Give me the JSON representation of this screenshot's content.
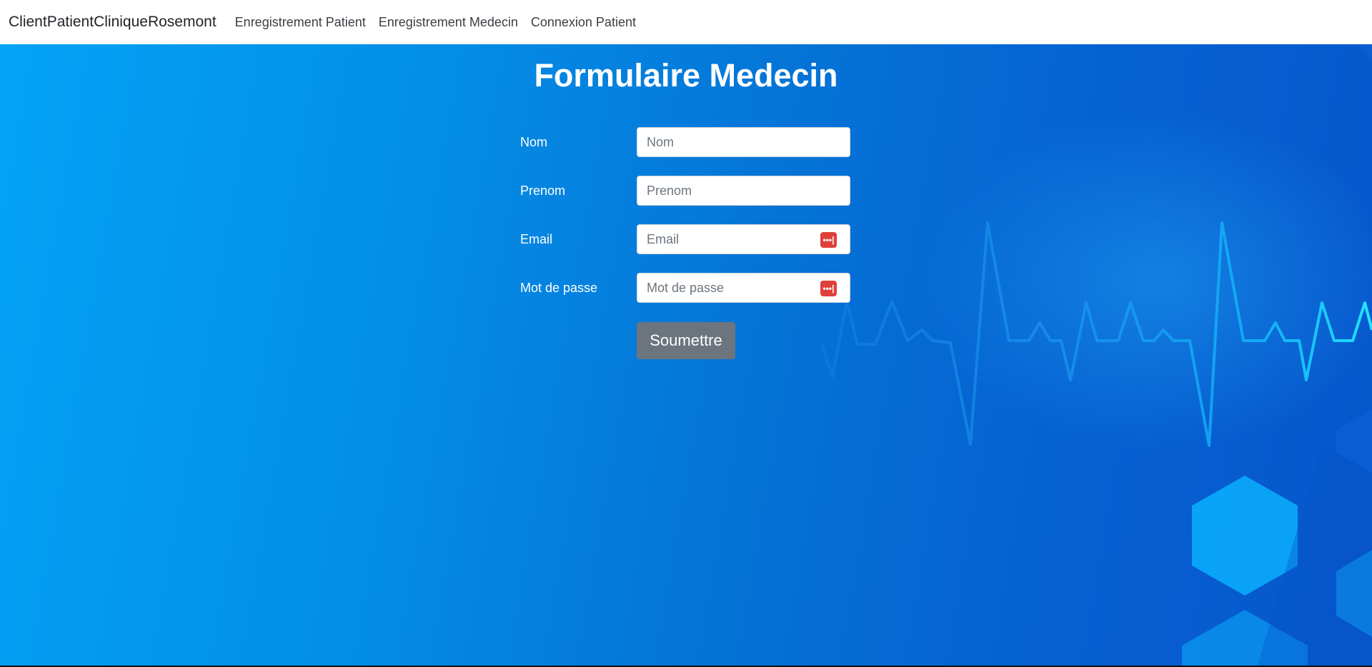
{
  "navbar": {
    "brand": "ClientPatientCliniqueRosemont",
    "links": [
      "Enregistrement Patient",
      "Enregistrement Medecin",
      "Connexion Patient"
    ]
  },
  "page": {
    "title": "Formulaire Medecin"
  },
  "form": {
    "fields": [
      {
        "label": "Nom",
        "placeholder": "Nom",
        "value": ""
      },
      {
        "label": "Prenom",
        "placeholder": "Prenom",
        "value": ""
      },
      {
        "label": "Email",
        "placeholder": "Email",
        "value": ""
      },
      {
        "label": "Mot de passe",
        "placeholder": "Mot de passe",
        "value": ""
      }
    ],
    "password_manager_icon": "password-manager-icon",
    "submit_label": "Soumettre"
  },
  "colors": {
    "navbar_bg": "#ffffff",
    "hero_gradient_start": "#03a3f7",
    "hero_gradient_end": "#0756cc",
    "submit_bg": "#6c757d",
    "password_icon_bg": "#e0403a"
  }
}
